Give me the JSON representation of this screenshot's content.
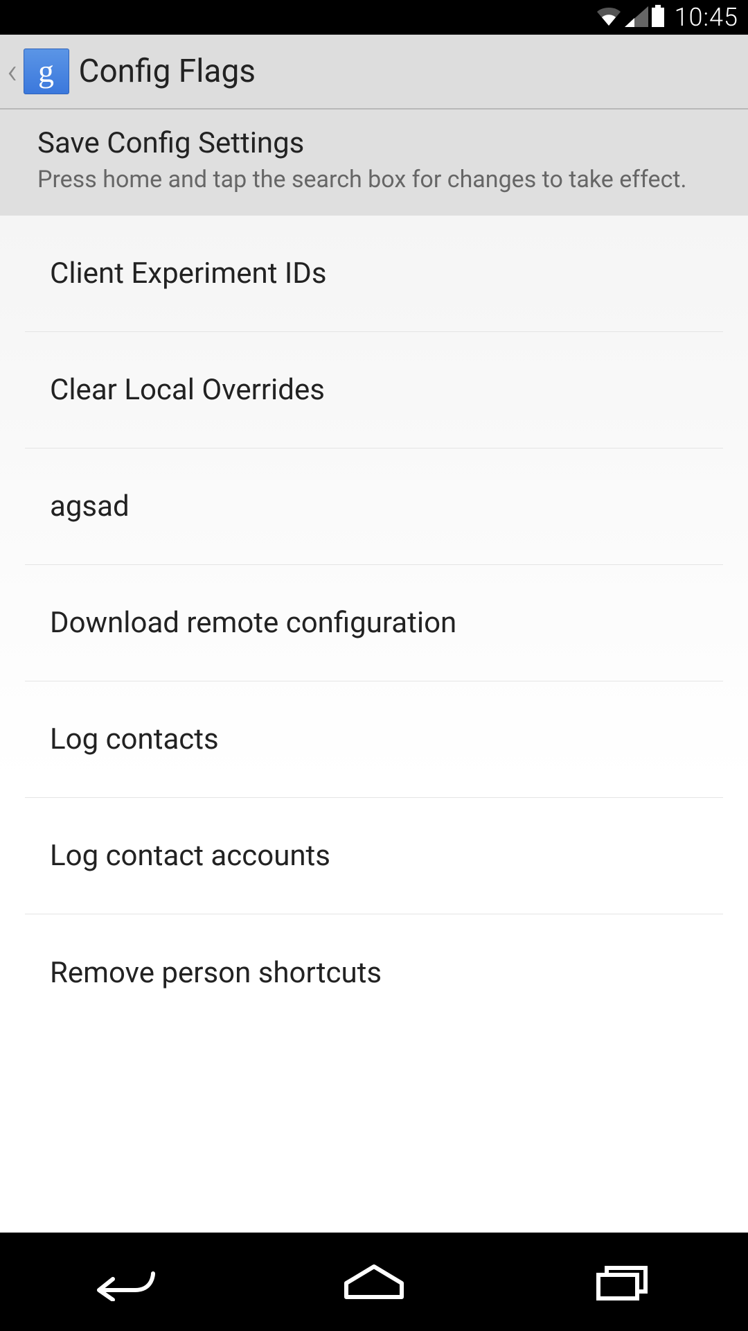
{
  "status": {
    "time": "10:45"
  },
  "action_bar": {
    "title": "Config Flags",
    "app_letter": "g"
  },
  "highlight": {
    "title": "Save Config Settings",
    "subtitle": "Press home and tap the search box for changes to take effect."
  },
  "items": [
    {
      "label": "Client Experiment IDs"
    },
    {
      "label": "Clear Local Overrides"
    },
    {
      "label": "agsad"
    },
    {
      "label": "Download remote configuration"
    },
    {
      "label": "Log contacts"
    },
    {
      "label": "Log contact accounts"
    },
    {
      "label": "Remove person shortcuts"
    }
  ]
}
